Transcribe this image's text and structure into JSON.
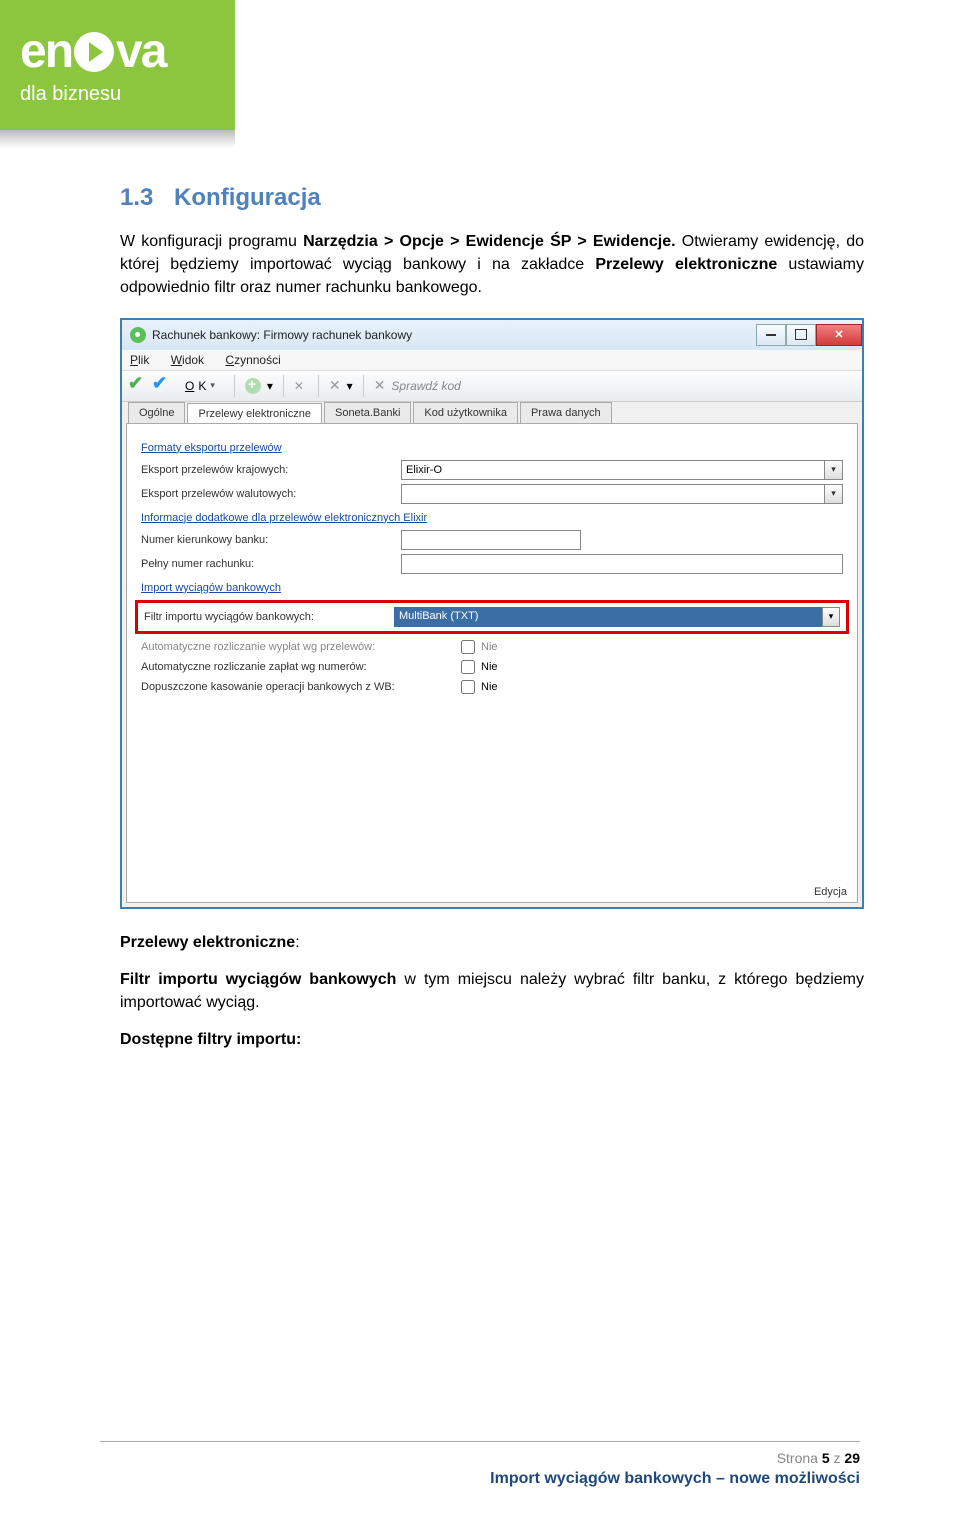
{
  "logo": {
    "brand": "en",
    "brand2": "va",
    "sub": "dla biznesu"
  },
  "section": {
    "num": "1.3",
    "title": "Konfiguracja"
  },
  "intro": {
    "p1a": "W konfiguracji programu ",
    "p1b": "Narzędzia > Opcje > Ewidencje ŚP > Ewidencje.",
    "p1c": " Otwieramy ewidencję, do której będziemy importować wyciąg bankowy i na zakładce ",
    "p1d": "Przelewy elektroniczne",
    "p1e": " ustawiamy odpowiednio filtr oraz numer rachunku bankowego."
  },
  "window": {
    "title": "Rachunek bankowy: Firmowy rachunek bankowy",
    "menu": {
      "plik": "Plik",
      "widok": "Widok",
      "czynnosci": "Czynności"
    },
    "toolbar": {
      "ok": "OK",
      "kod": "Sprawdź kod"
    },
    "tabs": {
      "t1": "Ogólne",
      "t2": "Przelewy elektroniczne",
      "t3": "Soneta.Banki",
      "t4": "Kod użytkownika",
      "t5": "Prawa danych"
    },
    "group1": "Formaty eksportu przelewów",
    "lbl_eks_kraj": "Eksport przelewów krajowych:",
    "val_eks_kraj": "Elixir-O",
    "lbl_eks_wal": "Eksport przelewów walutowych:",
    "group2": "Informacje dodatkowe dla przelewów elektronicznych Elixir",
    "lbl_kier": "Numer kierunkowy banku:",
    "lbl_rach": "Pełny numer rachunku:",
    "group3": "Import wyciągów bankowych",
    "lbl_filtr": "Filtr importu wyciągów bankowych:",
    "val_filtr": "MultiBank (TXT)",
    "lbl_auto1": "Automatyczne rozliczanie wypłat wg przelewów:",
    "lbl_auto2": "Automatyczne rozliczanie zapłat wg numerów:",
    "lbl_dop": "Dopuszczone kasowanie operacji bankowych z WB:",
    "nie": "Nie",
    "edycja": "Edycja"
  },
  "after": {
    "h": "Przelewy elektroniczne",
    "p_a": "Filtr importu wyciągów bankowych",
    "p_b": " w tym miejscu należy wybrać filtr banku, z którego będziemy importować wyciąg.",
    "p2": "Dostępne filtry importu:"
  },
  "footer": {
    "page_a": "Strona ",
    "page_b": "5",
    "page_c": " z ",
    "page_d": "29",
    "title": "Import wyciągów bankowych – nowe możliwości"
  }
}
